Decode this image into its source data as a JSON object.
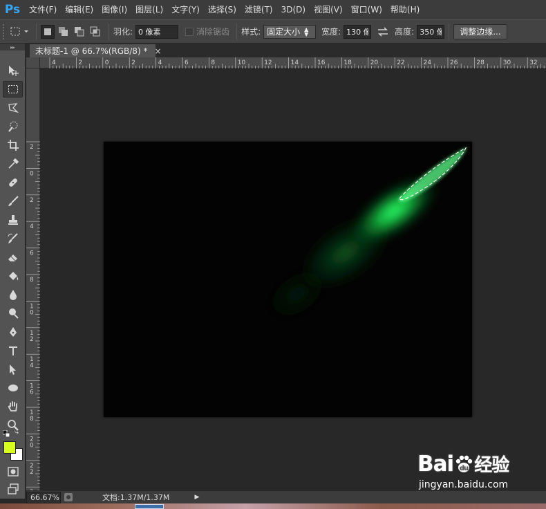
{
  "app": {
    "logo": "Ps"
  },
  "menu": {
    "items": [
      "文件(F)",
      "编辑(E)",
      "图像(I)",
      "图层(L)",
      "文字(Y)",
      "选择(S)",
      "滤镜(T)",
      "3D(D)",
      "视图(V)",
      "窗口(W)",
      "帮助(H)"
    ]
  },
  "options": {
    "feather_label": "羽化:",
    "feather_value": "0 像素",
    "antialias_label": "消除锯齿",
    "style_label": "样式:",
    "style_value": "固定大小",
    "width_label": "宽度:",
    "width_value": "130 像",
    "height_label": "高度:",
    "height_value": "350 像",
    "refine_label": "调整边缘..."
  },
  "document": {
    "tab_title": "未标题-1 @ 66.7%(RGB/8) *",
    "tab_close": "×"
  },
  "rulers": {
    "h_labels": [
      "4",
      "2",
      "0",
      "2",
      "4",
      "6",
      "8",
      "10",
      "12",
      "14",
      "16",
      "18",
      "20",
      "22",
      "24",
      "26",
      "28",
      "30",
      "32"
    ],
    "v_labels": [
      "2",
      "0",
      "2",
      "4",
      "6",
      "8",
      "10",
      "12",
      "14",
      "16",
      "18",
      "20",
      "22",
      "24"
    ]
  },
  "status": {
    "zoom": "66.67%",
    "doc_info": "文档:1.37M/1.37M",
    "arrow": "▶"
  },
  "colors": {
    "foreground": "#d9ff1f",
    "background": "#ffffff",
    "glow": "#22e055"
  },
  "watermark": {
    "logo_part1": "Bai",
    "logo_part2": "经验",
    "url": "jingyan.baidu.com"
  }
}
